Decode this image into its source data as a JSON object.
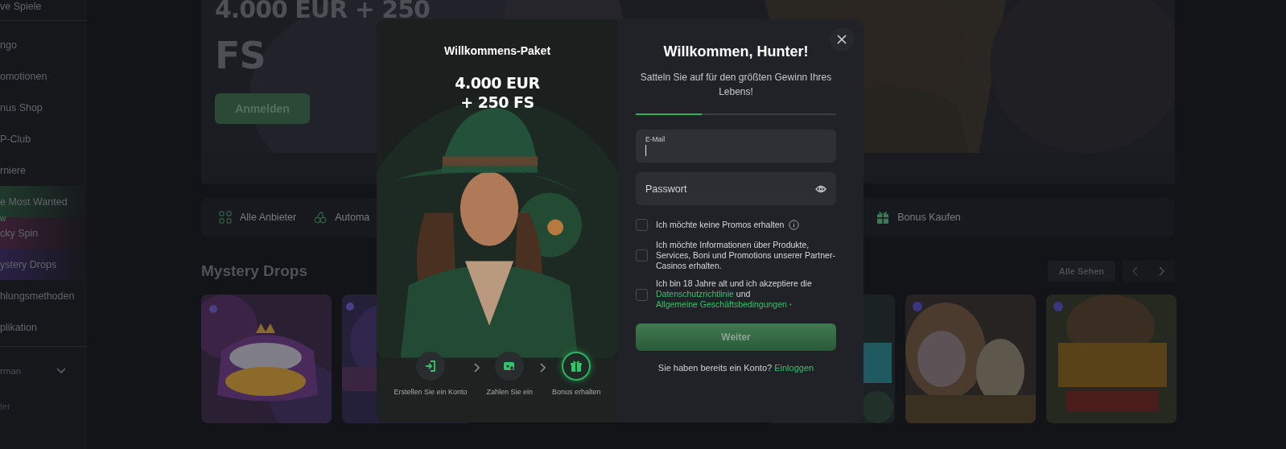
{
  "sidebar": {
    "items": [
      {
        "label": "ve Spiele"
      },
      {
        "label": "ngo"
      },
      {
        "label": "omotionen"
      },
      {
        "label": "nus Shop"
      },
      {
        "label": "P-Club"
      },
      {
        "label": "rniere"
      },
      {
        "label": "e Most Wanted",
        "color": "#1f3a2c"
      },
      {
        "label": "cky Spin",
        "badge": "w",
        "color": "#3a1f33"
      },
      {
        "label": "ystery Drops",
        "color": "#2a2147"
      },
      {
        "label": "hlungsmethoden"
      },
      {
        "label": "plikation"
      }
    ],
    "language": "rman",
    "footer_item": "ter"
  },
  "hero": {
    "title_lines": [
      "4.000 EUR + 250",
      "FS"
    ],
    "button": "Anmelden"
  },
  "providers": [
    {
      "label": "Alle Anbieter",
      "kind": "grid"
    },
    {
      "label": "Automa",
      "kind": "cherries"
    },
    {
      "label": "Bonus Kaufen",
      "kind": "gift"
    }
  ],
  "section": {
    "title": "Mystery Drops",
    "see_all": "Alle Sehen"
  },
  "modal": {
    "promo": {
      "title": "Willkommens-Paket",
      "amount_lines": [
        "4.000 EUR",
        "+ 250 FS"
      ],
      "steps": [
        {
          "label": "Erstellen Sie ein Konto",
          "kind": "account",
          "selected": false
        },
        {
          "label": "Zahlen Sie ein",
          "kind": "deposit",
          "selected": false
        },
        {
          "label": "Bonus erhalten",
          "kind": "gift",
          "selected": true
        }
      ]
    },
    "form": {
      "title": "Willkommen, Hunter!",
      "subtitle": "Satteln Sie auf für den größten Gewinn Ihres Lebens!",
      "progress": {
        "level": 0.33
      },
      "fields": [
        {
          "label": "E-Mail",
          "kind": "email",
          "focused": true
        },
        {
          "placeholder": "Passwort",
          "kind": "password",
          "focused": false
        }
      ],
      "checkboxes": [
        {
          "checked": false,
          "info": true,
          "segments": [
            {
              "kind": "text",
              "text": "Ich möchte keine Promos erhalten"
            }
          ]
        },
        {
          "checked": false,
          "info": false,
          "segments": [
            {
              "kind": "text",
              "text": "Ich möchte Informationen über Produkte, Services, Boni und Promotions unserer Partner-Casinos erhalten."
            }
          ]
        },
        {
          "checked": false,
          "info": false,
          "segments": [
            {
              "kind": "text",
              "text": "Ich bin 18 Jahre alt und ich akzeptiere die"
            },
            {
              "kind": "link",
              "text": "Datenschutzrichtlinie"
            },
            {
              "kind": "text",
              "text": "und"
            },
            {
              "kind": "link",
              "text": "Allgemeine Geschäftsbedingungen"
            },
            {
              "kind": "required",
              "text": "*"
            }
          ]
        }
      ],
      "submit": {
        "label": "Weiter",
        "disabled": true
      },
      "login_prompt": {
        "text": "Sie haben bereits ein Konto?",
        "link": "Einloggen"
      }
    }
  }
}
